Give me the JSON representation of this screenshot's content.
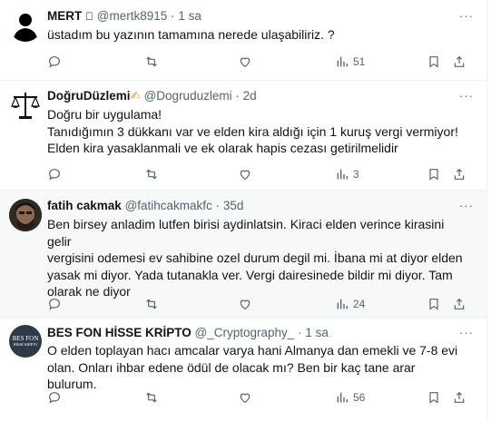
{
  "tweets": [
    {
      "name": "MERT",
      "name_suffix": "",
      "handle": "@mertk8915",
      "time": "1 sa",
      "lines": [
        "üstadım bu yazının tamamına nerede ulaşabiliriz. ?"
      ],
      "views": "51"
    },
    {
      "name": "DoğruDüzlemi",
      "name_suffix": "✍",
      "handle": "@Dogruduzlemi",
      "time": "2d",
      "lines": [
        "Doğru bir uygulama!",
        "Tanıdığımın 3 dükkanı var ve elden kira aldığı için 1 kuruş vergi vermiyor!",
        "Elden kira yasaklanmali ve ek olarak hapis cezası getirilmelidir"
      ],
      "views": "3"
    },
    {
      "name": "fatih cakmak",
      "name_suffix": "",
      "handle": "@fatihcakmakfc",
      "time": "35d",
      "lines": [
        "Ben birsey anladim lutfen birisi aydinlatsin. Kiraci elden verince kirasini gelir",
        "vergisini odemesi ev sahibine ozel durum degil mi. İbana mi at diyor elden",
        "yasak mi diyor. Yada tutanakla ver. Vergi dairesinede bildir mi diyor. Tam",
        "olarak ne diyor"
      ],
      "views": "24"
    },
    {
      "name": "BES FON HİSSE KRİPTO",
      "name_suffix": "",
      "handle": "@_Cryptography_",
      "time": "1 sa",
      "avatar_text": [
        "BES FON",
        "HİSSE KRİPTO"
      ],
      "lines": [
        "O elden toplayan hacı amcalar varya hani Almanya dan emekli ve 7-8 evi",
        "olan. Onları ihbar edene ödül de olacak mı? Ben bir kaç tane arar bulurum."
      ],
      "views": "56"
    }
  ],
  "separator": "·",
  "more_label": "···",
  "colors": {
    "text": "#0f1419",
    "secondary": "#536471",
    "divider": "#eff3f4",
    "hover_bg": "#f7f9f9"
  }
}
